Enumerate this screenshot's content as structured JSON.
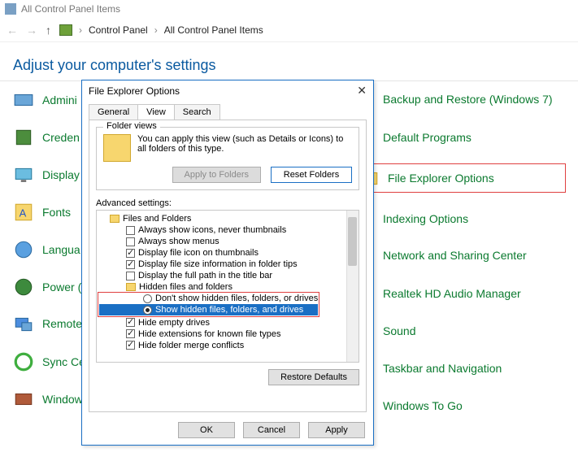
{
  "window": {
    "title": "All Control Panel Items"
  },
  "breadcrumb": {
    "root": "Control Panel",
    "current": "All Control Panel Items"
  },
  "heading": "Adjust your computer's settings",
  "left_items": [
    {
      "label": "Admini"
    },
    {
      "label": "Creden"
    },
    {
      "label": "Display"
    },
    {
      "label": "Fonts"
    },
    {
      "label": "Langua"
    },
    {
      "label": "Power ("
    },
    {
      "label": "Remote Connec"
    },
    {
      "label": "Sync Ce"
    },
    {
      "label": "Window"
    }
  ],
  "right_items": [
    {
      "label": "Backup and Restore (Windows 7)"
    },
    {
      "label": "Default Programs"
    },
    {
      "label": "File Explorer Options",
      "highlight": true
    },
    {
      "label": "Indexing Options"
    },
    {
      "label": "Network and Sharing Center"
    },
    {
      "label": "Realtek HD Audio Manager"
    },
    {
      "label": "Sound"
    },
    {
      "label": "Taskbar and Navigation"
    },
    {
      "label": "Windows To Go"
    }
  ],
  "dialog": {
    "title": "File Explorer Options",
    "tabs": {
      "general": "General",
      "view": "View",
      "search": "Search"
    },
    "folder_views": {
      "legend": "Folder views",
      "text": "You can apply this view (such as Details or Icons) to all folders of this type.",
      "apply": "Apply to Folders",
      "reset": "Reset Folders"
    },
    "advanced_label": "Advanced settings:",
    "tree": {
      "root": "Files and Folders",
      "items": [
        {
          "type": "check",
          "checked": false,
          "label": "Always show icons, never thumbnails"
        },
        {
          "type": "check",
          "checked": false,
          "label": "Always show menus"
        },
        {
          "type": "check",
          "checked": true,
          "label": "Display file icon on thumbnails"
        },
        {
          "type": "check",
          "checked": true,
          "label": "Display file size information in folder tips"
        },
        {
          "type": "check",
          "checked": false,
          "label": "Display the full path in the title bar"
        }
      ],
      "hidden_group": "Hidden files and folders",
      "radio_a": "Don't show hidden files, folders, or drives",
      "radio_b": "Show hidden files, folders, and drives",
      "tail": [
        {
          "checked": true,
          "label": "Hide empty drives"
        },
        {
          "checked": true,
          "label": "Hide extensions for known file types"
        },
        {
          "checked": true,
          "label": "Hide folder merge conflicts"
        }
      ]
    },
    "restore": "Restore Defaults",
    "buttons": {
      "ok": "OK",
      "cancel": "Cancel",
      "apply": "Apply"
    }
  }
}
